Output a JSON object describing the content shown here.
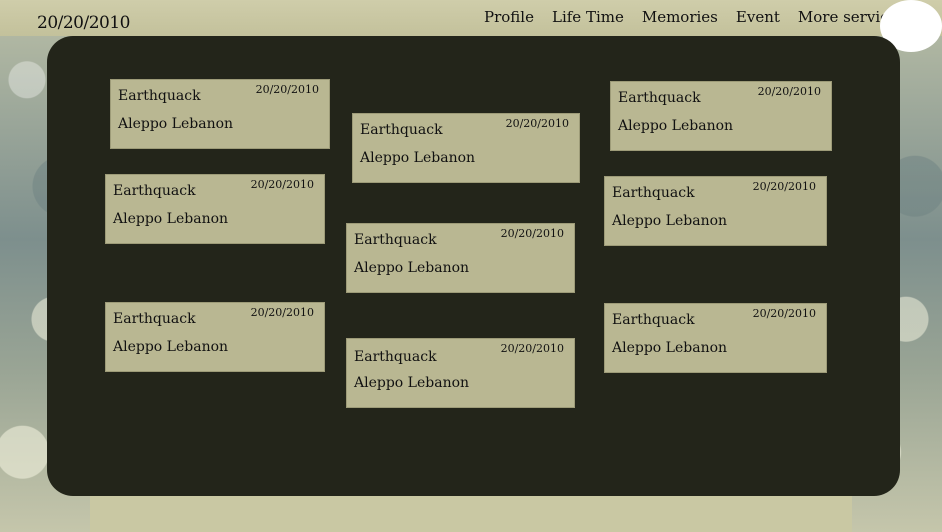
{
  "header": {
    "date": "20/20/2010",
    "nav": [
      "Profile",
      "Life Time",
      "Memories",
      "Event",
      "More services"
    ]
  },
  "cards": [
    {
      "title": "Earthquack",
      "place": "Aleppo Lebanon",
      "date": "20/20/2010"
    },
    {
      "title": "Earthquack",
      "place": "Aleppo Lebanon",
      "date": "20/20/2010"
    },
    {
      "title": "Earthquack",
      "place": "Aleppo Lebanon",
      "date": "20/20/2010"
    },
    {
      "title": "Earthquack",
      "place": "Aleppo Lebanon",
      "date": "20/20/2010"
    },
    {
      "title": "Earthquack",
      "place": "Aleppo Lebanon",
      "date": "20/20/2010"
    },
    {
      "title": "Earthquack",
      "place": "Aleppo Lebanon",
      "date": "20/20/2010"
    },
    {
      "title": "Earthquack",
      "place": "Aleppo Lebanon",
      "date": "20/20/2010"
    },
    {
      "title": "Earthquack",
      "place": "Aleppo Lebanon",
      "date": "20/20/2010"
    },
    {
      "title": "Earthquack",
      "place": "Aleppo Lebanon",
      "date": "20/20/2010"
    }
  ],
  "colors": {
    "panel": "#23251a",
    "card": "#b9b792",
    "page": "#c9c8a3"
  }
}
